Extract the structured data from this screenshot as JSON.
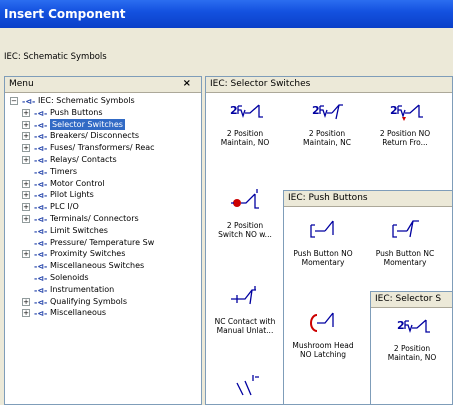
{
  "window": {
    "title": "Insert Component"
  },
  "subtitle": "IEC: Schematic Symbols",
  "menu": {
    "header": "Menu",
    "close_glyph": "×",
    "root": "IEC: Schematic Symbols",
    "items": [
      {
        "label": "Push Buttons",
        "expandable": true
      },
      {
        "label": "Selector Switches",
        "expandable": true,
        "selected": true
      },
      {
        "label": "Breakers/ Disconnects",
        "expandable": true
      },
      {
        "label": "Fuses/ Transformers/ Reac",
        "expandable": true
      },
      {
        "label": "Relays/ Contacts",
        "expandable": true
      },
      {
        "label": "Timers",
        "expandable": false
      },
      {
        "label": "Motor Control",
        "expandable": true
      },
      {
        "label": "Pilot Lights",
        "expandable": true
      },
      {
        "label": "PLC I/O",
        "expandable": true
      },
      {
        "label": "Terminals/ Connectors",
        "expandable": true
      },
      {
        "label": "Limit Switches",
        "expandable": false
      },
      {
        "label": "Pressure/ Temperature Sw",
        "expandable": false
      },
      {
        "label": "Proximity Switches",
        "expandable": true
      },
      {
        "label": "Miscellaneous Switches",
        "expandable": false
      },
      {
        "label": "Solenoids",
        "expandable": false
      },
      {
        "label": "Instrumentation",
        "expandable": false
      },
      {
        "label": "Qualifying Symbols",
        "expandable": true
      },
      {
        "label": "Miscellaneous",
        "expandable": true
      }
    ]
  },
  "gallery_main": {
    "title": "IEC: Selector Switches",
    "items": [
      {
        "line1": "2 Position",
        "line2": "Maintain, NO",
        "icon": "selector-switch-no-icon"
      },
      {
        "line1": "2 Position",
        "line2": "Maintain, NC",
        "icon": "selector-switch-nc-icon"
      },
      {
        "line1": "2 Position NO",
        "line2": "Return Fro...",
        "icon": "selector-switch-return-icon"
      },
      {
        "line1": "2 Position",
        "line2": "Switch NO w...",
        "icon": "selector-switch-lamp-icon"
      },
      {
        "line1": "NC Contact with",
        "line2": "Manual Unlat...",
        "icon": "contact-manual-unlatch-icon"
      },
      {
        "line1": "",
        "line2": "",
        "icon": "contact-partial-icon"
      }
    ]
  },
  "gallery_push": {
    "title": "IEC: Push Buttons",
    "items": [
      {
        "line1": "Push Button NO",
        "line2": "Momentary",
        "icon": "push-button-no-icon"
      },
      {
        "line1": "Push Button NC",
        "line2": "Momentary",
        "icon": "push-button-nc-icon"
      },
      {
        "line1": "Mushroom Head",
        "line2": "NO Latching",
        "icon": "mushroom-head-icon"
      }
    ]
  },
  "gallery_selector2": {
    "title": "IEC: Selector S",
    "items": [
      {
        "line1": "2 Position",
        "line2": "Maintain, NO",
        "icon": "selector-switch-no-icon"
      }
    ]
  },
  "colors": {
    "title_bar": "#1452e0",
    "selection": "#316ac5",
    "symbol_blue": "#0000a0",
    "symbol_red": "#cc0000"
  }
}
